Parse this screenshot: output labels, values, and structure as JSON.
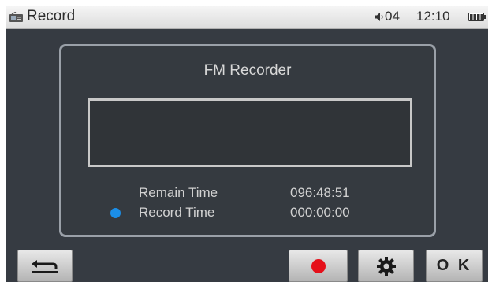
{
  "statusbar": {
    "app_icon": "radio-recorder-icon",
    "title": "Record",
    "volume_icon": "speaker-icon",
    "volume": "04",
    "time": "12:10",
    "battery_icon": "battery-icon"
  },
  "dialog": {
    "title": "FM Recorder",
    "remain_label": "Remain Time",
    "remain_value": "096:48:51",
    "record_label": "Record Time",
    "record_value": "000:00:00",
    "record_dot_color": "#1b8ee8"
  },
  "toolbar": {
    "back_icon": "return-arrow-icon",
    "record_icon": "record-dot-icon",
    "record_color": "#e5101a",
    "settings_icon": "gear-icon",
    "ok_label": "O K"
  },
  "colors": {
    "background": "#363b42",
    "statusbar": "#e8e8e8",
    "border": "#9aa0a8"
  }
}
